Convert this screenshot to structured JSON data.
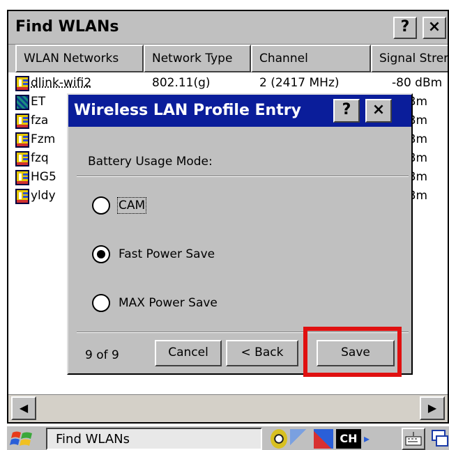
{
  "window": {
    "title": "Find WLANs",
    "help_label": "?",
    "close_label": "×"
  },
  "columns": [
    "WLAN Networks",
    "Network Type",
    "Channel",
    "Signal Stren"
  ],
  "networks": [
    {
      "name": "dlink-wifi2",
      "type": "802.11(g)",
      "channel": "2 (2417 MHz)",
      "signal": "-80 dBm",
      "icon": "profile-icon"
    },
    {
      "name": "ET",
      "type": "",
      "channel": "",
      "signal": "dBm",
      "icon": "adhoc-network-icon"
    },
    {
      "name": "fza",
      "type": "",
      "channel": "",
      "signal": "dBm",
      "icon": "profile-icon"
    },
    {
      "name": "Fzm",
      "type": "",
      "channel": "",
      "signal": "dBm",
      "icon": "profile-icon"
    },
    {
      "name": "fzq",
      "type": "",
      "channel": "",
      "signal": "dBm",
      "icon": "profile-icon"
    },
    {
      "name": "HG5",
      "type": "",
      "channel": "",
      "signal": "dBm",
      "icon": "profile-icon"
    },
    {
      "name": "yldy",
      "type": "",
      "channel": "",
      "signal": "dBm",
      "icon": "profile-icon"
    }
  ],
  "dialog": {
    "title": "Wireless LAN Profile Entry",
    "help_label": "?",
    "close_label": "×",
    "section_label": "Battery Usage Mode:",
    "options": [
      {
        "label": "CAM",
        "selected": false,
        "focused": true
      },
      {
        "label": "Fast Power Save",
        "selected": true,
        "focused": false
      },
      {
        "label": "MAX Power Save",
        "selected": false,
        "focused": false
      }
    ],
    "page_indicator": "9 of 9",
    "cancel_label": "Cancel",
    "back_label": "< Back",
    "save_label": "Save"
  },
  "scrollbar": {
    "left_arrow": "◀",
    "right_arrow": "▶"
  },
  "taskbar": {
    "task_label": "Find WLANs",
    "lang_badge": "CH",
    "tray_arrow": "▸"
  },
  "colors": {
    "dialog_title": "#0a1d9a",
    "highlight": "#e01010"
  }
}
